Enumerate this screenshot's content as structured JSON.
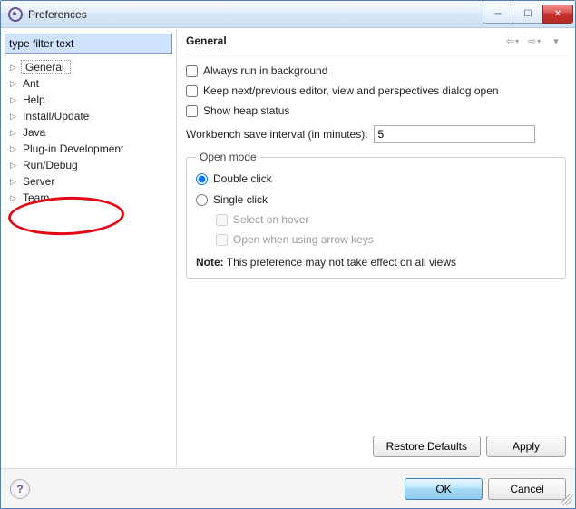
{
  "title": "Preferences",
  "filter_text": "type filter text",
  "tree": {
    "items": [
      {
        "label": "General",
        "selected": true
      },
      {
        "label": "Ant"
      },
      {
        "label": "Help"
      },
      {
        "label": "Install/Update"
      },
      {
        "label": "Java"
      },
      {
        "label": "Plug-in Development"
      },
      {
        "label": "Run/Debug"
      },
      {
        "label": "Server"
      },
      {
        "label": "Team"
      }
    ]
  },
  "page": {
    "title": "General",
    "checks": {
      "always_bg": "Always run in background",
      "keep_editor": "Keep next/previous editor, view and perspectives dialog open",
      "show_heap": "Show heap status"
    },
    "interval_label": "Workbench save interval (in minutes):",
    "interval_value": "5",
    "open_mode": {
      "legend": "Open mode",
      "double_click": "Double click",
      "single_click": "Single click",
      "select_hover": "Select on hover",
      "arrow_keys": "Open when using arrow keys",
      "note_prefix": "Note:",
      "note_text": " This preference may not take effect on all views"
    },
    "buttons": {
      "restore": "Restore Defaults",
      "apply": "Apply",
      "ok": "OK",
      "cancel": "Cancel"
    }
  }
}
